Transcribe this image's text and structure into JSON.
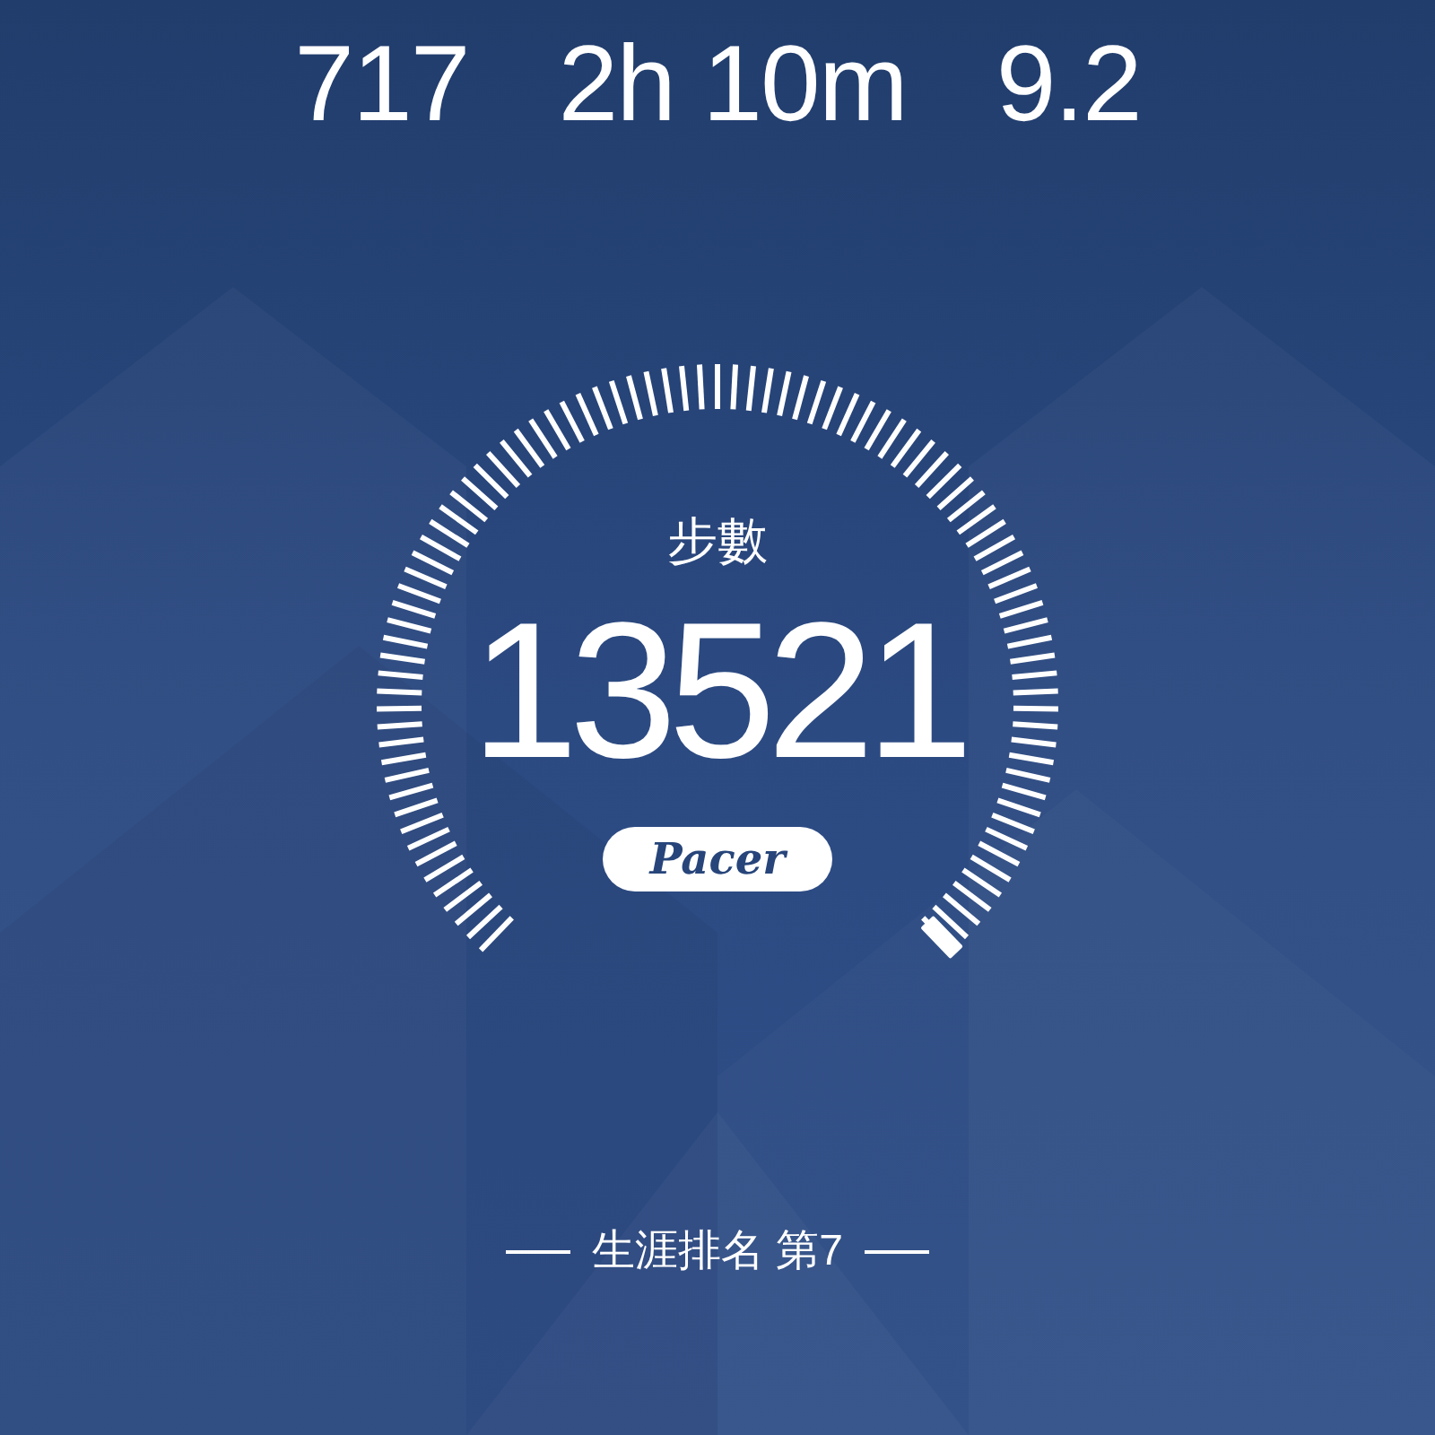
{
  "stats": [
    {
      "value": "717"
    },
    {
      "value": "2h 10m"
    },
    {
      "value": "9.2"
    }
  ],
  "gauge": {
    "label": "步數",
    "value": "13521"
  },
  "logo": "Pacer",
  "rank": "生涯排名 第7"
}
